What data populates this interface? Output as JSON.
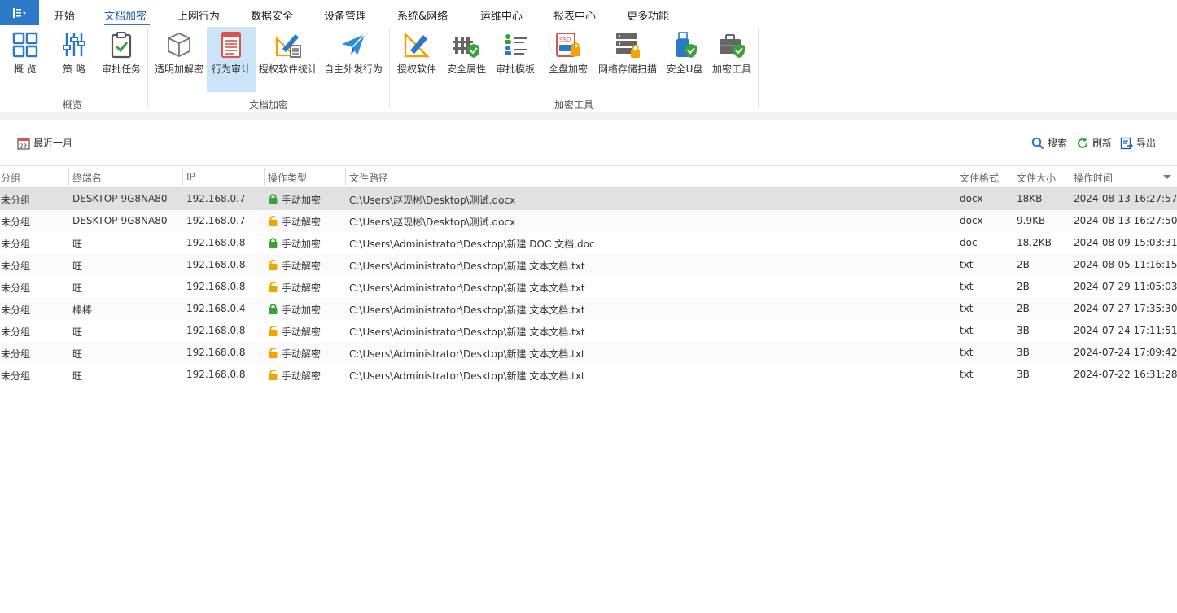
{
  "menu": {
    "app_icon": "list-menu-icon",
    "items": [
      "开始",
      "文档加密",
      "上网行为",
      "数据安全",
      "设备管理",
      "系统&网络",
      "运维中心",
      "报表中心",
      "更多功能"
    ],
    "active": "文档加密"
  },
  "ribbon": {
    "buttons": [
      {
        "label": "概 览",
        "icon": "grid-icon"
      },
      {
        "label": "策 略",
        "icon": "sliders-icon"
      },
      {
        "label": "审批任务",
        "icon": "clipboard-check-icon"
      },
      {
        "label": "透明加解密",
        "icon": "cube-icon"
      },
      {
        "label": "行为审计",
        "icon": "document-list-icon",
        "selected": true
      },
      {
        "label": "授权软件统计",
        "icon": "pen-ruler-list-icon"
      },
      {
        "label": "自主外发行为",
        "icon": "paper-plane-icon"
      },
      {
        "label": "授权软件",
        "icon": "pen-ruler-icon"
      },
      {
        "label": "安全属性",
        "icon": "fence-shield-icon"
      },
      {
        "label": "审批模板",
        "icon": "people-list-icon"
      },
      {
        "label": "全盘加密",
        "icon": "ssd-lock-icon"
      },
      {
        "label": "网络存储扫描",
        "icon": "server-lock-icon"
      },
      {
        "label": "安全U盘",
        "icon": "usb-shield-icon"
      },
      {
        "label": "加密工具",
        "icon": "toolbox-shield-icon"
      }
    ],
    "groups": [
      "概览",
      "文档加密",
      "加密工具"
    ]
  },
  "toolbar": {
    "date_range": "最近一月",
    "search": "搜索",
    "refresh": "刷新",
    "export": "导出"
  },
  "table": {
    "columns": [
      "分组",
      "终端名",
      "IP",
      "操作类型",
      "文件路径",
      "文件格式",
      "文件大小",
      "操作时间"
    ],
    "rows": [
      {
        "group": "未分组",
        "terminal": "DESKTOP-9G8NA80",
        "ip": "192.168.0.7",
        "op": "手动加密",
        "lock": "locked",
        "path": "C:\\Users\\赵现彬\\Desktop\\测试.docx",
        "fmt": "docx",
        "size": "18KB",
        "time": "2024-08-13 16:27:57"
      },
      {
        "group": "未分组",
        "terminal": "DESKTOP-9G8NA80",
        "ip": "192.168.0.7",
        "op": "手动解密",
        "lock": "unlocked",
        "path": "C:\\Users\\赵现彬\\Desktop\\测试.docx",
        "fmt": "docx",
        "size": "9.9KB",
        "time": "2024-08-13 16:27:50"
      },
      {
        "group": "未分组",
        "terminal": "旺",
        "ip": "192.168.0.8",
        "op": "手动加密",
        "lock": "locked",
        "path": "C:\\Users\\Administrator\\Desktop\\新建 DOC 文档.doc",
        "fmt": "doc",
        "size": "18.2KB",
        "time": "2024-08-09 15:03:31"
      },
      {
        "group": "未分组",
        "terminal": "旺",
        "ip": "192.168.0.8",
        "op": "手动解密",
        "lock": "unlocked",
        "path": "C:\\Users\\Administrator\\Desktop\\新建 文本文档.txt",
        "fmt": "txt",
        "size": "2B",
        "time": "2024-08-05 11:16:15"
      },
      {
        "group": "未分组",
        "terminal": "旺",
        "ip": "192.168.0.8",
        "op": "手动解密",
        "lock": "unlocked",
        "path": "C:\\Users\\Administrator\\Desktop\\新建 文本文档.txt",
        "fmt": "txt",
        "size": "2B",
        "time": "2024-07-29 11:05:03"
      },
      {
        "group": "未分组",
        "terminal": "棒棒",
        "ip": "192.168.0.4",
        "op": "手动加密",
        "lock": "locked",
        "path": "C:\\Users\\Administrator\\Desktop\\新建 文本文档.txt",
        "fmt": "txt",
        "size": "2B",
        "time": "2024-07-27 17:35:30"
      },
      {
        "group": "未分组",
        "terminal": "旺",
        "ip": "192.168.0.8",
        "op": "手动解密",
        "lock": "unlocked",
        "path": "C:\\Users\\Administrator\\Desktop\\新建 文本文档.txt",
        "fmt": "txt",
        "size": "3B",
        "time": "2024-07-24 17:11:51"
      },
      {
        "group": "未分组",
        "terminal": "旺",
        "ip": "192.168.0.8",
        "op": "手动解密",
        "lock": "unlocked",
        "path": "C:\\Users\\Administrator\\Desktop\\新建 文本文档.txt",
        "fmt": "txt",
        "size": "3B",
        "time": "2024-07-24 17:09:42"
      },
      {
        "group": "未分组",
        "terminal": "旺",
        "ip": "192.168.0.8",
        "op": "手动解密",
        "lock": "unlocked",
        "path": "C:\\Users\\Administrator\\Desktop\\新建 文本文档.txt",
        "fmt": "txt",
        "size": "3B",
        "time": "2024-07-22 16:31:28"
      }
    ]
  },
  "colors": {
    "accent": "#2b79c7",
    "locked": "#3aa13a",
    "unlocked": "#f5a300",
    "selected_row": "#e1e1e1",
    "selected_button": "#cce4f7"
  }
}
